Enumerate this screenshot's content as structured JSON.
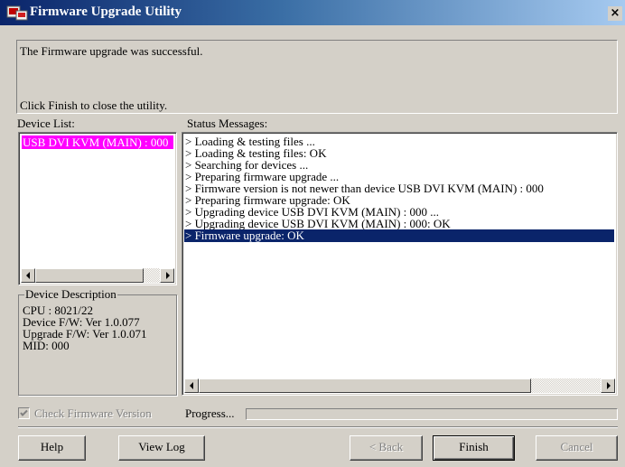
{
  "window": {
    "title": "Firmware Upgrade Utility",
    "close_label": "×"
  },
  "info": {
    "line1": "The Firmware upgrade was successful.",
    "line2": "Click Finish to close the utility."
  },
  "device_list": {
    "label": "Device List:",
    "items": [
      "USB DVI KVM (MAIN) : 000"
    ]
  },
  "device_description": {
    "title": "Device Description",
    "lines": [
      "CPU : 8021/22",
      "Device F/W: Ver 1.0.077",
      "Upgrade F/W: Ver 1.0.071",
      "MID: 000"
    ]
  },
  "status": {
    "label": "Status Messages:",
    "messages": [
      "> Loading & testing files ...",
      "> Loading & testing files: OK",
      "> Searching for devices ...",
      "> Preparing firmware upgrade ...",
      "> Firmware version is not newer than device USB DVI KVM (MAIN) : 000",
      "> Preparing firmware upgrade: OK",
      "> Upgrading device USB DVI KVM (MAIN) : 000 ...",
      "> Upgrading device USB DVI KVM (MAIN) : 000: OK",
      "> Firmware upgrade: OK"
    ],
    "selected_index": 8
  },
  "options": {
    "check_firmware_label": "Check Firmware Version",
    "check_firmware_checked": true,
    "check_firmware_enabled": false
  },
  "progress": {
    "label": "Progress...",
    "value": 0
  },
  "buttons": {
    "help": "Help",
    "view_log": "View Log",
    "back": "< Back",
    "finish": "Finish",
    "cancel": "Cancel"
  },
  "colors": {
    "device_highlight": "#ff00ff",
    "selection": "#0a246a",
    "face": "#d4d0c8"
  }
}
